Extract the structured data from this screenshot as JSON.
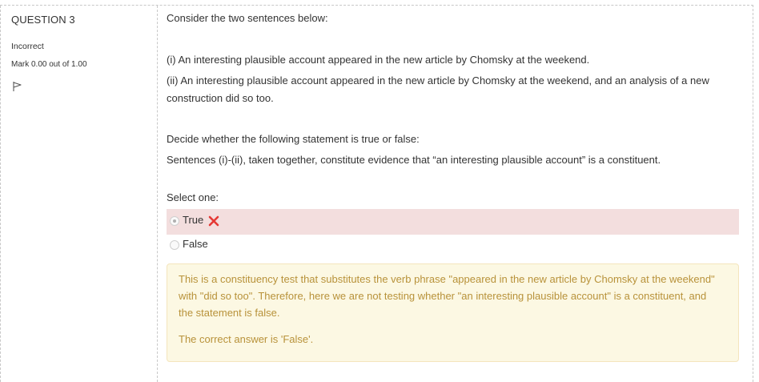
{
  "info": {
    "question_title": "QUESTION 3",
    "state": "Incorrect",
    "grade": "Mark 0.00 out of 1.00",
    "flag_icon": "flag-icon"
  },
  "question": {
    "intro": "Consider the two sentences below:",
    "sentence_1": "(i) An interesting plausible account appeared in the new article by Chomsky at the weekend.",
    "sentence_2": "(ii) An interesting plausible account appeared in the new article by Chomsky at the weekend, and an analysis of a new construction did so too.",
    "prompt": "Decide whether the following statement is true or false:",
    "statement": "Sentences (i)-(ii), taken together, constitute evidence that “an interesting plausible account” is a constituent.",
    "select_label": "Select one:"
  },
  "options": [
    {
      "label": "True",
      "selected": true,
      "status": "incorrect"
    },
    {
      "label": "False",
      "selected": false,
      "status": ""
    }
  ],
  "feedback": {
    "general": "This is a constituency test that substitutes the verb phrase \"appeared in the new article by Chomsky at the weekend\" with \"did so too\". Therefore, here we are not testing whether \"an interesting plausible account\" is a constituent, and the statement is false.",
    "right_answer": "The correct answer is 'False'."
  },
  "colors": {
    "incorrect_bg": "#f3dede",
    "feedback_bg": "#fcf8e3",
    "feedback_text": "#b8923a",
    "incorrect_mark": "#e53935"
  }
}
